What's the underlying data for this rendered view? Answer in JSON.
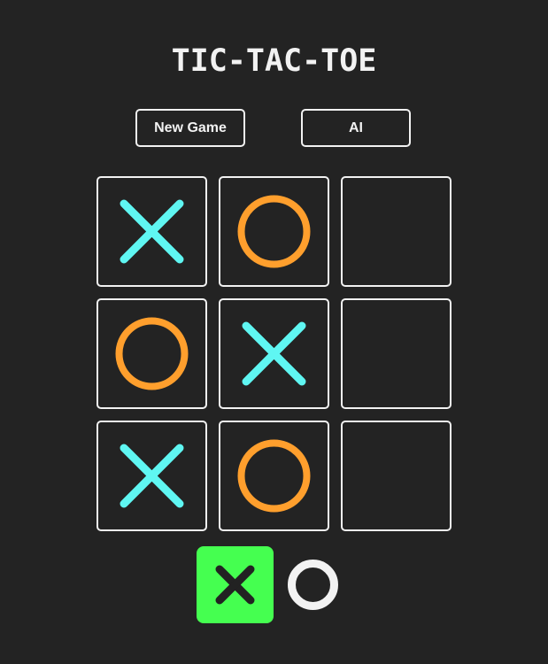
{
  "game": {
    "title": "TIC-TAC-TOE"
  },
  "controls": {
    "new_game_label": "New Game",
    "ai_label": "AI"
  },
  "board": {
    "cells": [
      [
        "X",
        "O",
        ""
      ],
      [
        "O",
        "X",
        ""
      ],
      [
        "X",
        "O",
        ""
      ]
    ]
  },
  "turn_indicator": {
    "active": "X",
    "options": [
      "X",
      "O"
    ]
  },
  "colors": {
    "background": "#232323",
    "foreground": "#f2f2f2",
    "x_mark": "#5ff6f2",
    "o_mark": "#ff9f2d",
    "active_turn_bg": "#45ff50",
    "active_turn_mark": "#222222",
    "inactive_turn_mark": "#f2f2f2"
  }
}
